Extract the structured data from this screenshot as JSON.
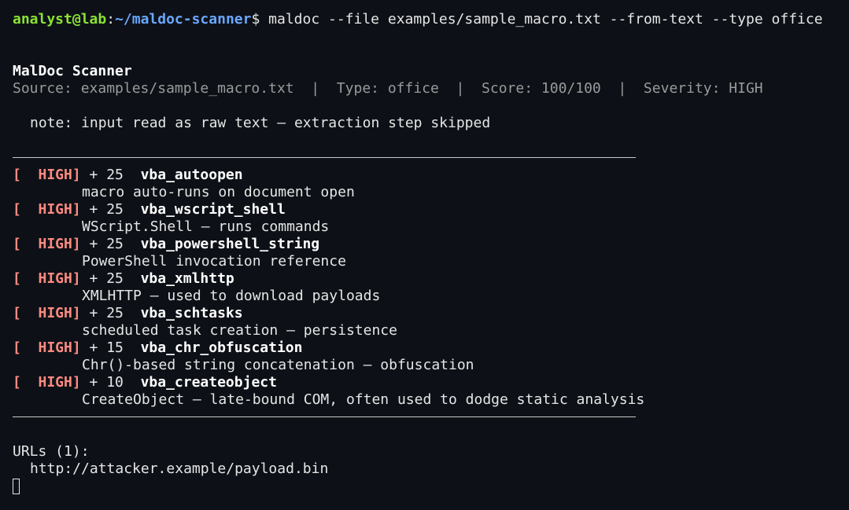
{
  "prompt": {
    "user_host": "analyst@lab",
    "sep": ":",
    "path": "~/maldoc-scanner",
    "symbol": "$",
    "command": "maldoc --file examples/sample_macro.txt --from-text --type office"
  },
  "report": {
    "title": "MalDoc Scanner",
    "source_line": "Source: examples/sample_macro.txt  |  Type: office  |  Score: 100/100  |  Severity: HIGH",
    "note": "note: input read as raw text — extraction step skipped"
  },
  "findings": [
    {
      "severity": "[  HIGH]",
      "points": " + 25  ",
      "rule": "vba_autoopen",
      "desc": "macro auto-runs on document open"
    },
    {
      "severity": "[  HIGH]",
      "points": " + 25  ",
      "rule": "vba_wscript_shell",
      "desc": "WScript.Shell — runs commands"
    },
    {
      "severity": "[  HIGH]",
      "points": " + 25  ",
      "rule": "vba_powershell_string",
      "desc": "PowerShell invocation reference"
    },
    {
      "severity": "[  HIGH]",
      "points": " + 25  ",
      "rule": "vba_xmlhttp",
      "desc": "XMLHTTP — used to download payloads"
    },
    {
      "severity": "[  HIGH]",
      "points": " + 25  ",
      "rule": "vba_schtasks",
      "desc": "scheduled task creation — persistence"
    },
    {
      "severity": "[  HIGH]",
      "points": " + 15  ",
      "rule": "vba_chr_obfuscation",
      "desc": "Chr()-based string concatenation — obfuscation"
    },
    {
      "severity": "[  HIGH]",
      "points": " + 10  ",
      "rule": "vba_createobject",
      "desc": "CreateObject — late-bound COM, often used to dodge static analysis"
    }
  ],
  "urls": {
    "header": "URLs (1):",
    "items": [
      "http://attacker.example/payload.bin"
    ]
  },
  "colors": {
    "background": "#0d1117",
    "user": "#8ae234",
    "path": "#6aa7ff",
    "severity_high": "#ff8a80"
  }
}
